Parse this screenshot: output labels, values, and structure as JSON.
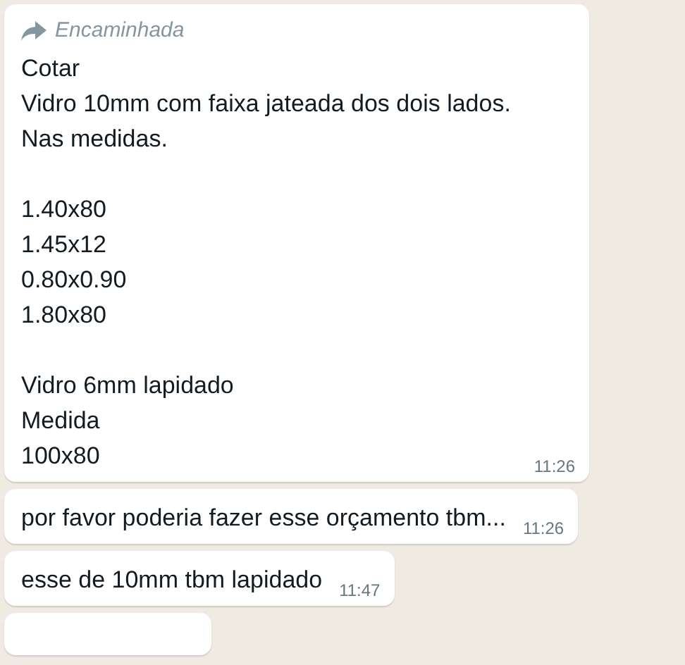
{
  "messages": [
    {
      "forwarded": true,
      "forwarded_label": "Encaminhada",
      "text": "Cotar\nVidro 10mm com faixa jateada dos dois lados.\nNas medidas.\n\n1.40x80\n1.45x12\n0.80x0.90\n1.80x80\n\nVidro 6mm lapidado\nMedida\n100x80",
      "time": "11:26"
    },
    {
      "forwarded": false,
      "text": "por favor poderia fazer esse orçamento tbm...",
      "time": "11:26"
    },
    {
      "forwarded": false,
      "text": "esse de 10mm tbm lapidado",
      "time": "11:47"
    }
  ]
}
